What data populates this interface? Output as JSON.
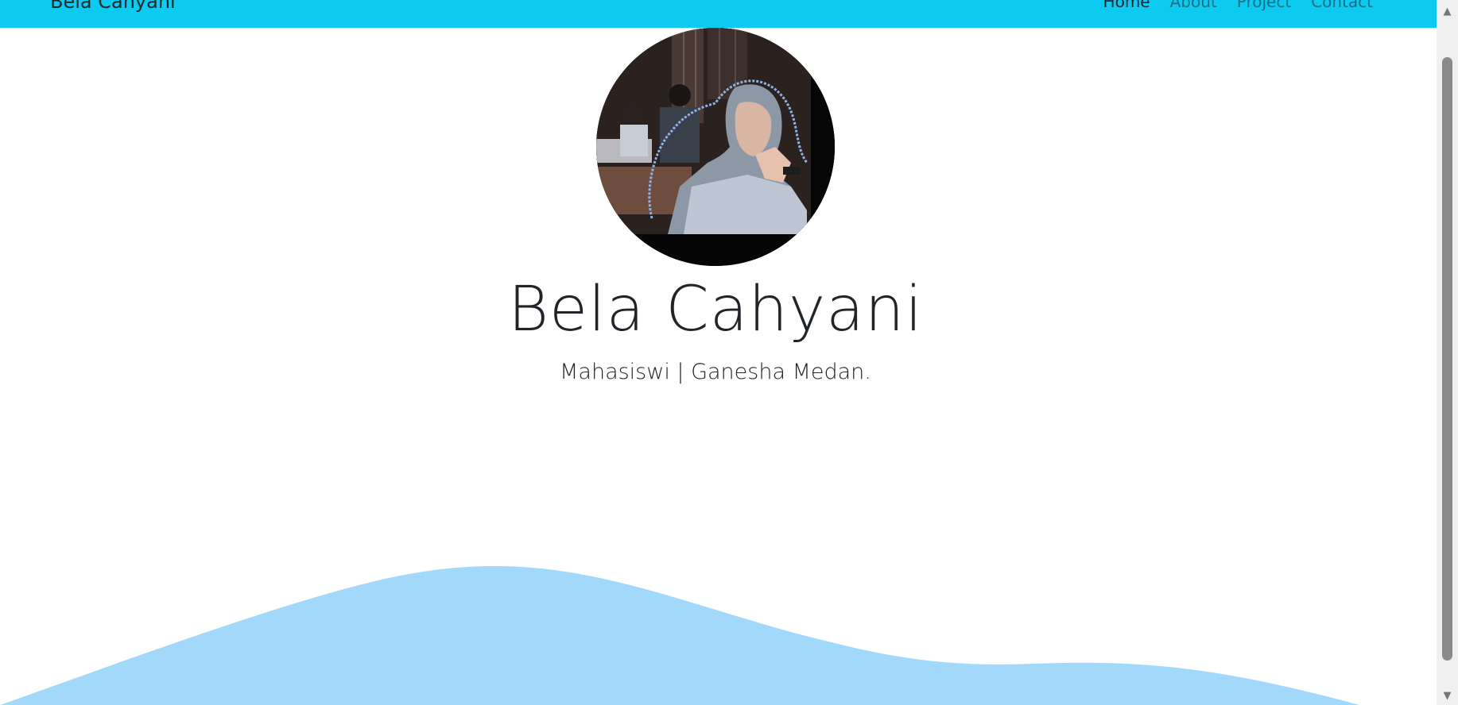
{
  "navbar": {
    "brand": "Bela Cahyani",
    "links": [
      {
        "label": "Home",
        "active": true
      },
      {
        "label": "About",
        "active": false
      },
      {
        "label": "Project",
        "active": false
      },
      {
        "label": "Contact",
        "active": false
      }
    ],
    "background": "#0dcaf0"
  },
  "hero": {
    "avatar_alt": "profile-photo",
    "name": "Bela Cahyani",
    "tagline": "Mahasiswi | Ganesha Medan."
  },
  "colors": {
    "wave": "#a2d9fa",
    "text": "#212529"
  }
}
